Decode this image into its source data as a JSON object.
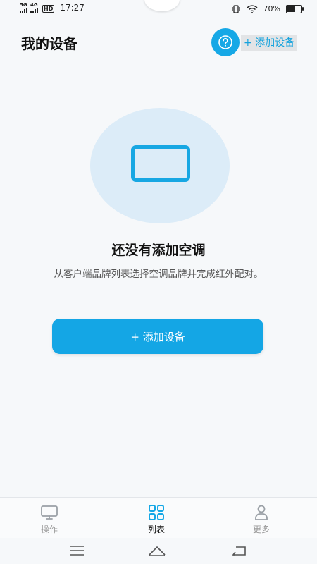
{
  "status_bar": {
    "signal_1_label": "5G",
    "signal_2_label": "4G",
    "hd_label": "HD",
    "time": "17:27",
    "battery_percent": "70%",
    "battery_level": 0.7
  },
  "header": {
    "title": "我的设备",
    "help_icon": "question-circle-icon",
    "add_label": "+ 添加设备"
  },
  "empty_state": {
    "illustration_icon": "air-conditioner-icon",
    "title": "还没有添加空调",
    "description": "从客户端品牌列表选择空调品牌并完成红外配对。",
    "add_button_label": "+ 添加设备"
  },
  "tabs": [
    {
      "label": "操作",
      "icon": "monitor-icon",
      "active": false
    },
    {
      "label": "列表",
      "icon": "grid-icon",
      "active": true
    },
    {
      "label": "更多",
      "icon": "person-icon",
      "active": false
    }
  ],
  "colors": {
    "accent": "#16a8e6",
    "hero_circle": "#dcecf8",
    "background": "#f6f8fa"
  },
  "system_nav": [
    "menu-icon",
    "home-icon",
    "back-icon"
  ]
}
